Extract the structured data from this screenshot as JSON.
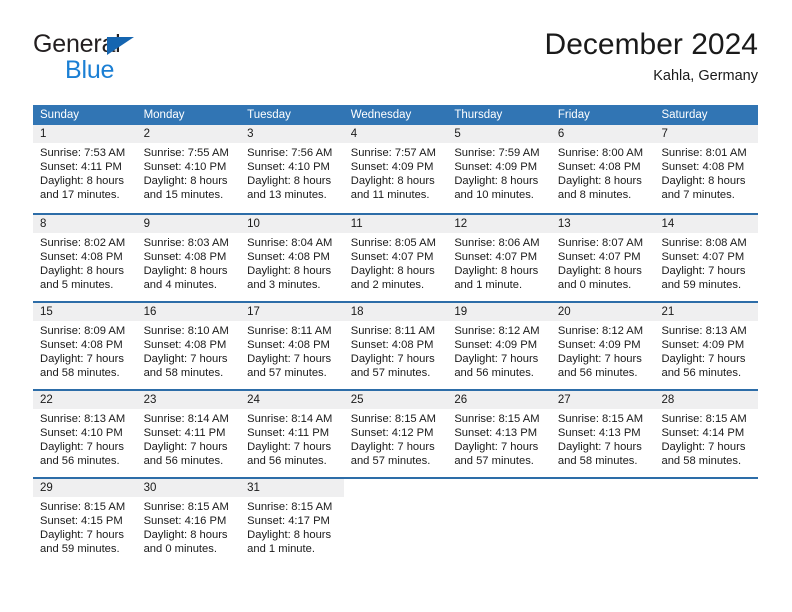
{
  "brand": {
    "word_one": "General",
    "word_two": "Blue",
    "triangle_icon": "triangle-icon",
    "accent_dark": "#1565b0",
    "accent_light": "#1b7fd4"
  },
  "header": {
    "title": "December 2024",
    "location": "Kahla, Germany"
  },
  "theme": {
    "header_blue": "#3175b4",
    "week_divider_blue": "#2d6da8",
    "day_number_band": "#efeff0"
  },
  "weekdays": [
    "Sunday",
    "Monday",
    "Tuesday",
    "Wednesday",
    "Thursday",
    "Friday",
    "Saturday"
  ],
  "weeks": [
    [
      {
        "day": "1",
        "lines": [
          "Sunrise: 7:53 AM",
          "Sunset: 4:11 PM",
          "Daylight: 8 hours",
          "and 17 minutes."
        ]
      },
      {
        "day": "2",
        "lines": [
          "Sunrise: 7:55 AM",
          "Sunset: 4:10 PM",
          "Daylight: 8 hours",
          "and 15 minutes."
        ]
      },
      {
        "day": "3",
        "lines": [
          "Sunrise: 7:56 AM",
          "Sunset: 4:10 PM",
          "Daylight: 8 hours",
          "and 13 minutes."
        ]
      },
      {
        "day": "4",
        "lines": [
          "Sunrise: 7:57 AM",
          "Sunset: 4:09 PM",
          "Daylight: 8 hours",
          "and 11 minutes."
        ]
      },
      {
        "day": "5",
        "lines": [
          "Sunrise: 7:59 AM",
          "Sunset: 4:09 PM",
          "Daylight: 8 hours",
          "and 10 minutes."
        ]
      },
      {
        "day": "6",
        "lines": [
          "Sunrise: 8:00 AM",
          "Sunset: 4:08 PM",
          "Daylight: 8 hours",
          "and 8 minutes."
        ]
      },
      {
        "day": "7",
        "lines": [
          "Sunrise: 8:01 AM",
          "Sunset: 4:08 PM",
          "Daylight: 8 hours",
          "and 7 minutes."
        ]
      }
    ],
    [
      {
        "day": "8",
        "lines": [
          "Sunrise: 8:02 AM",
          "Sunset: 4:08 PM",
          "Daylight: 8 hours",
          "and 5 minutes."
        ]
      },
      {
        "day": "9",
        "lines": [
          "Sunrise: 8:03 AM",
          "Sunset: 4:08 PM",
          "Daylight: 8 hours",
          "and 4 minutes."
        ]
      },
      {
        "day": "10",
        "lines": [
          "Sunrise: 8:04 AM",
          "Sunset: 4:08 PM",
          "Daylight: 8 hours",
          "and 3 minutes."
        ]
      },
      {
        "day": "11",
        "lines": [
          "Sunrise: 8:05 AM",
          "Sunset: 4:07 PM",
          "Daylight: 8 hours",
          "and 2 minutes."
        ]
      },
      {
        "day": "12",
        "lines": [
          "Sunrise: 8:06 AM",
          "Sunset: 4:07 PM",
          "Daylight: 8 hours",
          "and 1 minute."
        ]
      },
      {
        "day": "13",
        "lines": [
          "Sunrise: 8:07 AM",
          "Sunset: 4:07 PM",
          "Daylight: 8 hours",
          "and 0 minutes."
        ]
      },
      {
        "day": "14",
        "lines": [
          "Sunrise: 8:08 AM",
          "Sunset: 4:07 PM",
          "Daylight: 7 hours",
          "and 59 minutes."
        ]
      }
    ],
    [
      {
        "day": "15",
        "lines": [
          "Sunrise: 8:09 AM",
          "Sunset: 4:08 PM",
          "Daylight: 7 hours",
          "and 58 minutes."
        ]
      },
      {
        "day": "16",
        "lines": [
          "Sunrise: 8:10 AM",
          "Sunset: 4:08 PM",
          "Daylight: 7 hours",
          "and 58 minutes."
        ]
      },
      {
        "day": "17",
        "lines": [
          "Sunrise: 8:11 AM",
          "Sunset: 4:08 PM",
          "Daylight: 7 hours",
          "and 57 minutes."
        ]
      },
      {
        "day": "18",
        "lines": [
          "Sunrise: 8:11 AM",
          "Sunset: 4:08 PM",
          "Daylight: 7 hours",
          "and 57 minutes."
        ]
      },
      {
        "day": "19",
        "lines": [
          "Sunrise: 8:12 AM",
          "Sunset: 4:09 PM",
          "Daylight: 7 hours",
          "and 56 minutes."
        ]
      },
      {
        "day": "20",
        "lines": [
          "Sunrise: 8:12 AM",
          "Sunset: 4:09 PM",
          "Daylight: 7 hours",
          "and 56 minutes."
        ]
      },
      {
        "day": "21",
        "lines": [
          "Sunrise: 8:13 AM",
          "Sunset: 4:09 PM",
          "Daylight: 7 hours",
          "and 56 minutes."
        ]
      }
    ],
    [
      {
        "day": "22",
        "lines": [
          "Sunrise: 8:13 AM",
          "Sunset: 4:10 PM",
          "Daylight: 7 hours",
          "and 56 minutes."
        ]
      },
      {
        "day": "23",
        "lines": [
          "Sunrise: 8:14 AM",
          "Sunset: 4:11 PM",
          "Daylight: 7 hours",
          "and 56 minutes."
        ]
      },
      {
        "day": "24",
        "lines": [
          "Sunrise: 8:14 AM",
          "Sunset: 4:11 PM",
          "Daylight: 7 hours",
          "and 56 minutes."
        ]
      },
      {
        "day": "25",
        "lines": [
          "Sunrise: 8:15 AM",
          "Sunset: 4:12 PM",
          "Daylight: 7 hours",
          "and 57 minutes."
        ]
      },
      {
        "day": "26",
        "lines": [
          "Sunrise: 8:15 AM",
          "Sunset: 4:13 PM",
          "Daylight: 7 hours",
          "and 57 minutes."
        ]
      },
      {
        "day": "27",
        "lines": [
          "Sunrise: 8:15 AM",
          "Sunset: 4:13 PM",
          "Daylight: 7 hours",
          "and 58 minutes."
        ]
      },
      {
        "day": "28",
        "lines": [
          "Sunrise: 8:15 AM",
          "Sunset: 4:14 PM",
          "Daylight: 7 hours",
          "and 58 minutes."
        ]
      }
    ],
    [
      {
        "day": "29",
        "lines": [
          "Sunrise: 8:15 AM",
          "Sunset: 4:15 PM",
          "Daylight: 7 hours",
          "and 59 minutes."
        ]
      },
      {
        "day": "30",
        "lines": [
          "Sunrise: 8:15 AM",
          "Sunset: 4:16 PM",
          "Daylight: 8 hours",
          "and 0 minutes."
        ]
      },
      {
        "day": "31",
        "lines": [
          "Sunrise: 8:15 AM",
          "Sunset: 4:17 PM",
          "Daylight: 8 hours",
          "and 1 minute."
        ]
      },
      {
        "day": "",
        "lines": []
      },
      {
        "day": "",
        "lines": []
      },
      {
        "day": "",
        "lines": []
      },
      {
        "day": "",
        "lines": []
      }
    ]
  ]
}
